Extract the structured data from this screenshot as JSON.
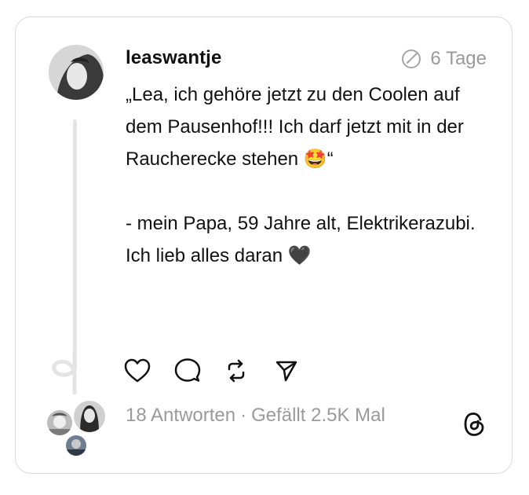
{
  "post": {
    "username": "leaswantje",
    "time_ago": "6 Tage",
    "text_paragraph_1": "„Lea, ich gehöre jetzt zu den Coolen auf dem Pausenhof!!! Ich darf jetzt mit in der Raucherecke stehen 🤩“",
    "text_paragraph_2": "- mein Papa, 59 Jahre alt, Elektrikerazubi.\nIch lieb alles daran 🖤"
  },
  "stats": {
    "replies": "18 Antworten",
    "separator": "·",
    "likes": "Gefällt 2.5K Mal"
  },
  "icons": {
    "time": "edit-circle-icon",
    "like": "heart-icon",
    "reply": "comment-icon",
    "repost": "repost-icon",
    "share": "send-icon",
    "brand": "threads-logo-icon"
  },
  "colors": {
    "muted_text": "#9a9a9a",
    "border": "#d9d9d9",
    "thread_line": "#e4e4e4"
  }
}
